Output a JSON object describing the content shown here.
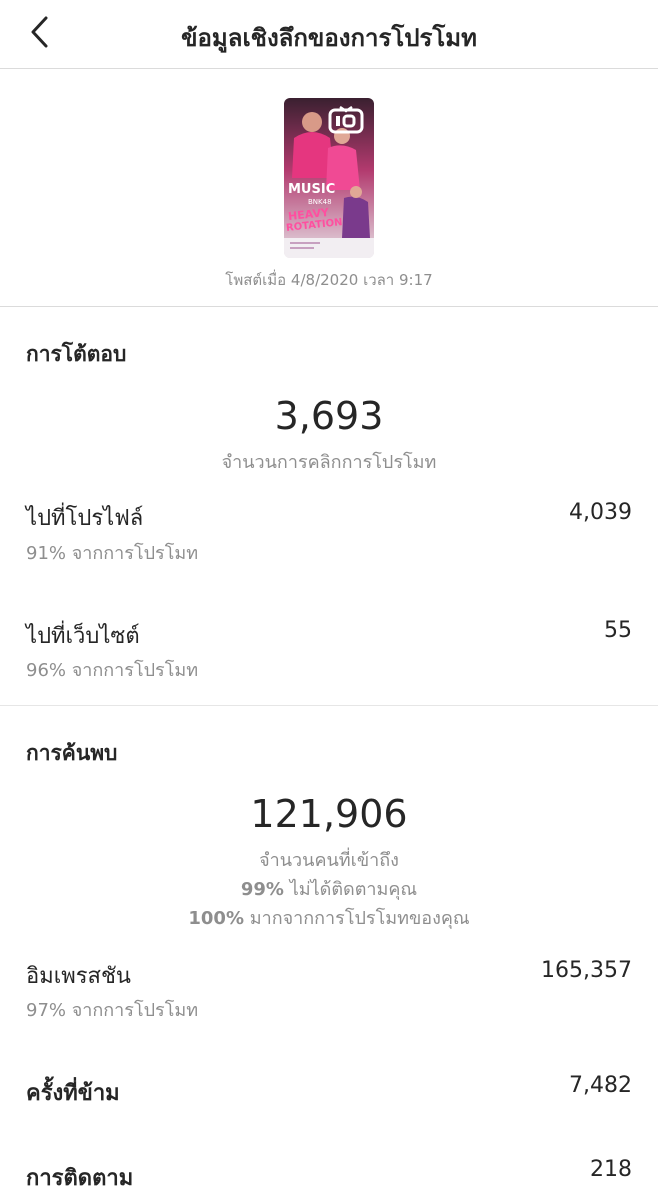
{
  "header": {
    "title": "ข้อมูลเชิงลึกของการโปรโมท",
    "back_icon": "chevron-left-icon"
  },
  "post": {
    "posted_at": "โพสต์เมื่อ 4/8/2020 เวลา 9:17",
    "thumb_text": {
      "music": "MUSIC",
      "group": "BNK48",
      "song_line1": "HEAVY",
      "song_line2": "ROTATION"
    },
    "thumb_icon": "igtv-icon",
    "colors": {
      "pink": "#e5367f",
      "purple": "#7a3a8c",
      "dark": "#3a2030"
    }
  },
  "interactions": {
    "title": "การโต้ตอบ",
    "total": "3,693",
    "total_label": "จำนวนการคลิกการโปรโมท",
    "rows": [
      {
        "label": "ไปที่โปรไฟล์",
        "sub": "91% จากการโปรโมท",
        "value": "4,039"
      },
      {
        "label": "ไปที่เว็บไซต์",
        "sub": "96% จากการโปรโมท",
        "value": "55"
      }
    ]
  },
  "discovery": {
    "title": "การค้นพบ",
    "total": "121,906",
    "total_label": "จำนวนคนที่เข้าถึง",
    "not_following_pct": "99%",
    "not_following_label": "ไม่ได้ติดตามคุณ",
    "from_promo_pct": "100%",
    "from_promo_label": "มากจากการโปรโมทของคุณ",
    "impressions": {
      "label": "อิมเพรสชัน",
      "sub": "97% จากการโปรโมท",
      "value": "165,357"
    },
    "skips": {
      "label": "ครั้งที่ข้าม",
      "value": "7,482"
    },
    "follows": {
      "label": "การติดตาม",
      "value": "218"
    }
  }
}
